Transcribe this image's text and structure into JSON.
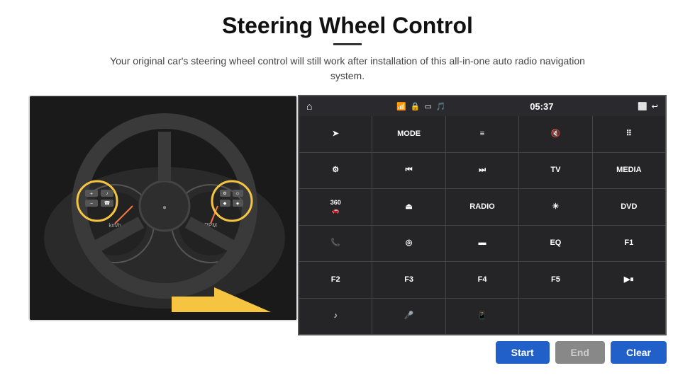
{
  "header": {
    "title": "Steering Wheel Control",
    "subtitle": "Your original car's steering wheel control will still work after installation of this all-in-one auto radio navigation system."
  },
  "status_bar": {
    "time": "05:37"
  },
  "grid": {
    "rows": [
      [
        {
          "type": "icon",
          "icon": "send",
          "label": ""
        },
        {
          "type": "text",
          "label": "MODE"
        },
        {
          "type": "icon",
          "icon": "list",
          "label": ""
        },
        {
          "type": "icon",
          "icon": "mute",
          "label": ""
        },
        {
          "type": "icon",
          "icon": "grid",
          "label": ""
        }
      ],
      [
        {
          "type": "icon",
          "icon": "settings",
          "label": ""
        },
        {
          "type": "icon",
          "icon": "rewind",
          "label": ""
        },
        {
          "type": "icon",
          "icon": "fastforward",
          "label": ""
        },
        {
          "type": "text",
          "label": "TV"
        },
        {
          "type": "text",
          "label": "MEDIA"
        }
      ],
      [
        {
          "type": "text",
          "label": "360"
        },
        {
          "type": "icon",
          "icon": "eject",
          "label": ""
        },
        {
          "type": "text",
          "label": "RADIO"
        },
        {
          "type": "icon",
          "icon": "brightness",
          "label": ""
        },
        {
          "type": "text",
          "label": "DVD"
        }
      ],
      [
        {
          "type": "icon",
          "icon": "phone",
          "label": ""
        },
        {
          "type": "icon",
          "icon": "swirl",
          "label": ""
        },
        {
          "type": "icon",
          "icon": "rect",
          "label": ""
        },
        {
          "type": "text",
          "label": "EQ"
        },
        {
          "type": "text",
          "label": "F1"
        }
      ],
      [
        {
          "type": "text",
          "label": "F2"
        },
        {
          "type": "text",
          "label": "F3"
        },
        {
          "type": "text",
          "label": "F4"
        },
        {
          "type": "text",
          "label": "F5"
        },
        {
          "type": "icon",
          "icon": "playpause",
          "label": ""
        }
      ],
      [
        {
          "type": "icon",
          "icon": "music",
          "label": ""
        },
        {
          "type": "icon",
          "icon": "mic",
          "label": ""
        },
        {
          "type": "icon",
          "icon": "phonecall",
          "label": ""
        },
        {
          "type": "empty",
          "label": ""
        },
        {
          "type": "empty",
          "label": ""
        }
      ]
    ]
  },
  "actions": {
    "start_label": "Start",
    "end_label": "End",
    "clear_label": "Clear"
  }
}
